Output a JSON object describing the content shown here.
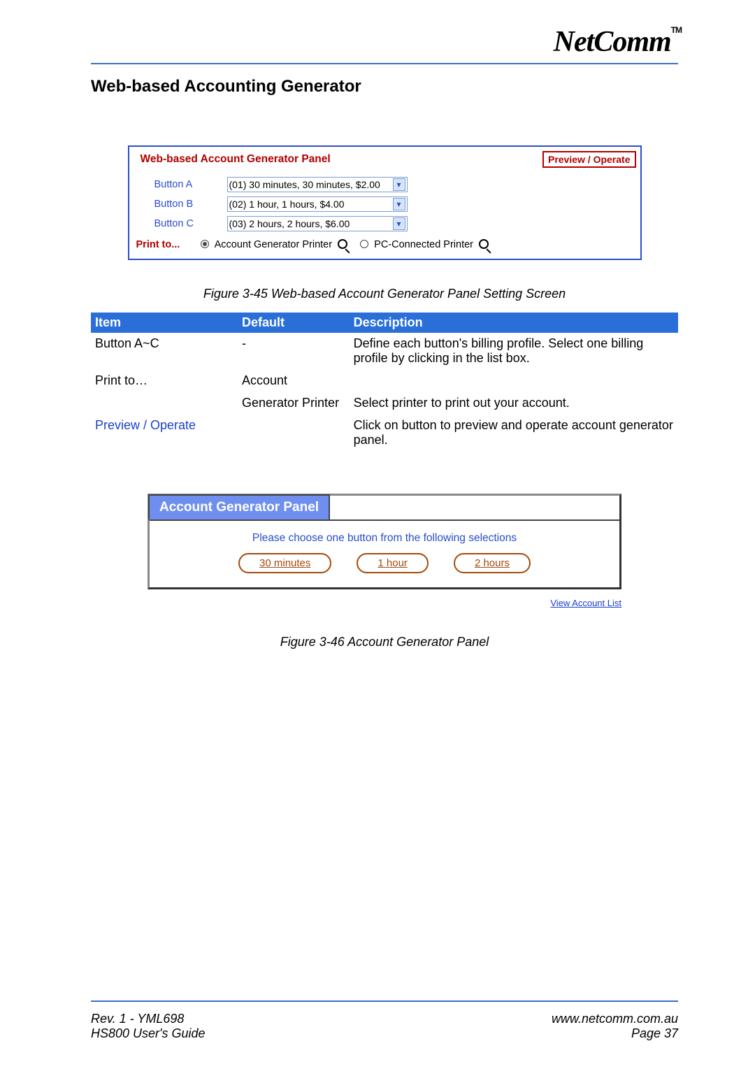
{
  "brand": {
    "name": "NetComm",
    "tm": "TM"
  },
  "section_title": "Web-based Accounting Generator",
  "panel1": {
    "title": "Web-based Account Generator Panel",
    "preview_label": "Preview / Operate",
    "rows": [
      {
        "label": "Button A",
        "value": "(01) 30 minutes, 30 minutes, $2.00"
      },
      {
        "label": "Button B",
        "value": "(02) 1 hour, 1 hours, $4.00"
      },
      {
        "label": "Button C",
        "value": "(03) 2 hours, 2 hours, $6.00"
      }
    ],
    "print_label": "Print to...",
    "radio1": "Account Generator Printer",
    "radio2": "PC-Connected Printer"
  },
  "figcap1": "Figure 3-45 Web-based Account Generator Panel Setting Screen",
  "table": {
    "headers": {
      "item": "Item",
      "def": "Default",
      "desc": "Description"
    },
    "rows": [
      {
        "item": "Button A~C",
        "def": "-",
        "desc": "Define each button's billing profile. Select one billing profile by clicking in the list box."
      },
      {
        "item": "Print to…",
        "def": "Account",
        "desc": ""
      },
      {
        "item": "",
        "def": "Generator Printer",
        "desc": "Select printer to print out your account."
      },
      {
        "item": "Preview / Operate",
        "item_link": true,
        "def": "",
        "desc": "Click on button to preview and operate account generator panel."
      }
    ]
  },
  "panel2": {
    "tab": "Account Generator Panel",
    "instruction": "Please choose one button from the following selections",
    "pills": [
      "30 minutes",
      "1 hour",
      "2 hours"
    ],
    "view_list": "View Account List"
  },
  "figcap2": "Figure 3-46 Account Generator Panel",
  "footer": {
    "left1": "Rev. 1 - YML698",
    "left2": "HS800 User's Guide",
    "right1": "www.netcomm.com.au",
    "right2": "Page 37"
  }
}
